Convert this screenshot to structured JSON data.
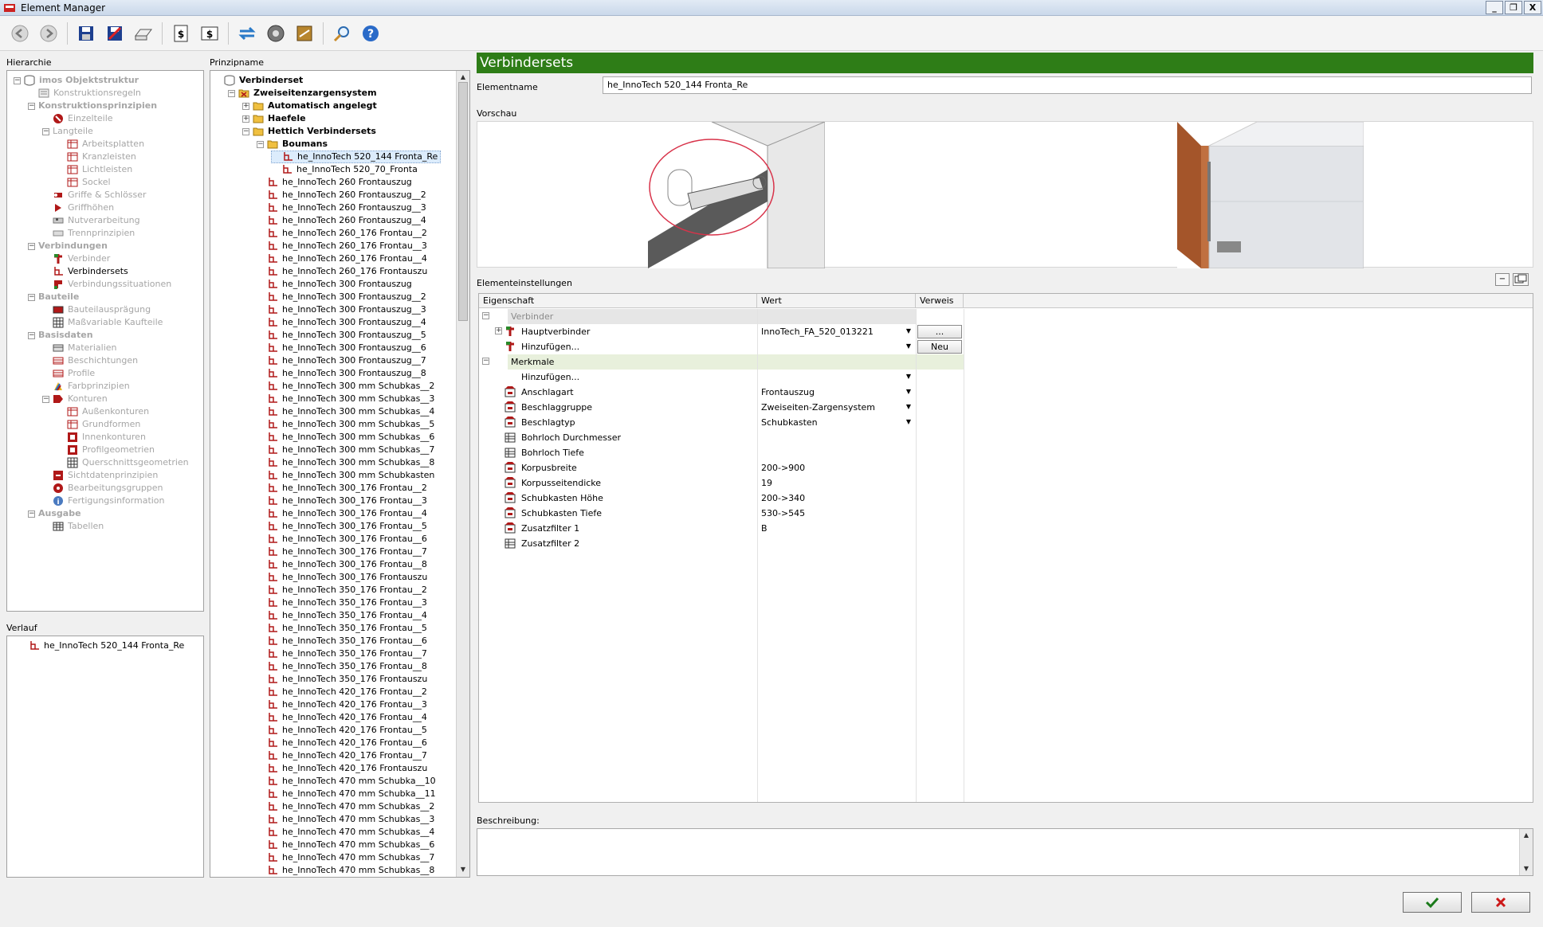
{
  "window": {
    "title": "Element Manager",
    "minimize": "_",
    "restore": "❐",
    "close": "X"
  },
  "panels": {
    "hierarchy_label": "Hierarchie",
    "principle_label": "Prinzipname",
    "history_label": "Verlauf",
    "preview_label": "Vorschau",
    "settings_label": "Elementeinstellungen",
    "description_label": "Beschreibung:",
    "element_name_label": "Elementname"
  },
  "hierarchy": [
    {
      "label": "imos Objektstruktur",
      "style": "greyb",
      "level": 0,
      "pm": "-",
      "icon": "db"
    },
    {
      "label": "Konstruktionsregeln",
      "style": "grey",
      "level": 1,
      "pm": "",
      "icon": "rule"
    },
    {
      "label": "Konstruktionsprinzipien",
      "style": "greyb",
      "level": 1,
      "pm": "-",
      "icon": ""
    },
    {
      "label": "Einzelteile",
      "style": "grey",
      "level": 2,
      "pm": "",
      "icon": "part"
    },
    {
      "label": "Langteile",
      "style": "grey",
      "level": 2,
      "pm": "-",
      "icon": ""
    },
    {
      "label": "Arbeitsplatten",
      "style": "grey",
      "level": 3,
      "pm": "",
      "icon": "board"
    },
    {
      "label": "Kranzleisten",
      "style": "grey",
      "level": 3,
      "pm": "",
      "icon": "board"
    },
    {
      "label": "Lichtleisten",
      "style": "grey",
      "level": 3,
      "pm": "",
      "icon": "board"
    },
    {
      "label": "Sockel",
      "style": "grey",
      "level": 3,
      "pm": "",
      "icon": "board"
    },
    {
      "label": "Griffe & Schlösser",
      "style": "grey",
      "level": 2,
      "pm": "",
      "icon": "handle"
    },
    {
      "label": "Griffhöhen",
      "style": "grey",
      "level": 2,
      "pm": "",
      "icon": "handle2"
    },
    {
      "label": "Nutverarbeitung",
      "style": "grey",
      "level": 2,
      "pm": "",
      "icon": "groove"
    },
    {
      "label": "Trennprinzipien",
      "style": "grey",
      "level": 2,
      "pm": "",
      "icon": "sep"
    },
    {
      "label": "Verbindungen",
      "style": "greyb",
      "level": 1,
      "pm": "-",
      "icon": ""
    },
    {
      "label": "Verbinder",
      "style": "grey",
      "level": 2,
      "pm": "",
      "icon": "conn"
    },
    {
      "label": "Verbindersets",
      "style": "",
      "level": 2,
      "pm": "",
      "icon": "connset"
    },
    {
      "label": "Verbindungssituationen",
      "style": "grey",
      "level": 2,
      "pm": "",
      "icon": "sit"
    },
    {
      "label": "Bauteile",
      "style": "greyb",
      "level": 1,
      "pm": "-",
      "icon": ""
    },
    {
      "label": "Bauteilausprägung",
      "style": "grey",
      "level": 2,
      "pm": "",
      "icon": "comp"
    },
    {
      "label": "Maßvariable Kaufteile",
      "style": "grey",
      "level": 2,
      "pm": "",
      "icon": "grid"
    },
    {
      "label": "Basisdaten",
      "style": "greyb",
      "level": 1,
      "pm": "-",
      "icon": ""
    },
    {
      "label": "Materialien",
      "style": "grey",
      "level": 2,
      "pm": "",
      "icon": "mat"
    },
    {
      "label": "Beschichtungen",
      "style": "grey",
      "level": 2,
      "pm": "",
      "icon": "coat"
    },
    {
      "label": "Profile",
      "style": "grey",
      "level": 2,
      "pm": "",
      "icon": "coat"
    },
    {
      "label": "Farbprinzipien",
      "style": "grey",
      "level": 2,
      "pm": "",
      "icon": "color"
    },
    {
      "label": "Konturen",
      "style": "grey",
      "level": 2,
      "pm": "-",
      "icon": "contour"
    },
    {
      "label": "Außenkonturen",
      "style": "grey",
      "level": 3,
      "pm": "",
      "icon": "board"
    },
    {
      "label": "Grundformen",
      "style": "grey",
      "level": 3,
      "pm": "",
      "icon": "board"
    },
    {
      "label": "Innenkonturen",
      "style": "grey",
      "level": 3,
      "pm": "",
      "icon": "inner"
    },
    {
      "label": "Profilgeometrien",
      "style": "grey",
      "level": 3,
      "pm": "",
      "icon": "inner"
    },
    {
      "label": "Querschnittsgeometrien",
      "style": "grey",
      "level": 3,
      "pm": "",
      "icon": "grid"
    },
    {
      "label": "Sichtdatenprinzipien",
      "style": "grey",
      "level": 2,
      "pm": "",
      "icon": "view"
    },
    {
      "label": "Bearbeitungsgruppen",
      "style": "grey",
      "level": 2,
      "pm": "",
      "icon": "group"
    },
    {
      "label": "Fertigungsinformation",
      "style": "grey",
      "level": 2,
      "pm": "",
      "icon": "info"
    },
    {
      "label": "Ausgabe",
      "style": "greyb",
      "level": 1,
      "pm": "-",
      "icon": ""
    },
    {
      "label": "Tabellen",
      "style": "grey",
      "level": 2,
      "pm": "",
      "icon": "table"
    }
  ],
  "history": [
    "he_InnoTech 520_144 Fronta_Re"
  ],
  "principles_top": [
    {
      "label": "Verbinderset",
      "style": "bold",
      "indent": 0,
      "pm": "",
      "icon": "db"
    },
    {
      "label": "Zweiseitenzargensystem",
      "style": "bold",
      "indent": 1,
      "pm": "-",
      "icon": "folderx"
    },
    {
      "label": "Automatisch angelegt",
      "style": "bold",
      "indent": 2,
      "pm": "+",
      "icon": "folder"
    },
    {
      "label": "Haefele",
      "style": "bold",
      "indent": 2,
      "pm": "+",
      "icon": "folder"
    },
    {
      "label": "Hettich Verbindersets",
      "style": "bold",
      "indent": 2,
      "pm": "-",
      "icon": "folder"
    },
    {
      "label": "Boumans",
      "style": "bold",
      "indent": 3,
      "pm": "-",
      "icon": "folder"
    },
    {
      "label": "he_InnoTech 520_144 Fronta_Re",
      "style": "sel",
      "indent": 4,
      "pm": "",
      "icon": "connset"
    },
    {
      "label": "he_InnoTech 520_70_Fronta",
      "style": "",
      "indent": 4,
      "pm": "",
      "icon": "connset"
    }
  ],
  "principles_items": [
    "he_InnoTech 260 Frontauszug",
    "he_InnoTech 260 Frontauszug__2",
    "he_InnoTech 260 Frontauszug__3",
    "he_InnoTech 260 Frontauszug__4",
    "he_InnoTech 260_176 Frontau__2",
    "he_InnoTech 260_176 Frontau__3",
    "he_InnoTech 260_176 Frontau__4",
    "he_InnoTech 260_176 Frontauszu",
    "he_InnoTech 300 Frontauszug",
    "he_InnoTech 300 Frontauszug__2",
    "he_InnoTech 300 Frontauszug__3",
    "he_InnoTech 300 Frontauszug__4",
    "he_InnoTech 300 Frontauszug__5",
    "he_InnoTech 300 Frontauszug__6",
    "he_InnoTech 300 Frontauszug__7",
    "he_InnoTech 300 Frontauszug__8",
    "he_InnoTech 300 mm Schubkas__2",
    "he_InnoTech 300 mm Schubkas__3",
    "he_InnoTech 300 mm Schubkas__4",
    "he_InnoTech 300 mm Schubkas__5",
    "he_InnoTech 300 mm Schubkas__6",
    "he_InnoTech 300 mm Schubkas__7",
    "he_InnoTech 300 mm Schubkas__8",
    "he_InnoTech 300 mm Schubkasten",
    "he_InnoTech 300_176 Frontau__2",
    "he_InnoTech 300_176 Frontau__3",
    "he_InnoTech 300_176 Frontau__4",
    "he_InnoTech 300_176 Frontau__5",
    "he_InnoTech 300_176 Frontau__6",
    "he_InnoTech 300_176 Frontau__7",
    "he_InnoTech 300_176 Frontau__8",
    "he_InnoTech 300_176 Frontauszu",
    "he_InnoTech 350_176 Frontau__2",
    "he_InnoTech 350_176 Frontau__3",
    "he_InnoTech 350_176 Frontau__4",
    "he_InnoTech 350_176 Frontau__5",
    "he_InnoTech 350_176 Frontau__6",
    "he_InnoTech 350_176 Frontau__7",
    "he_InnoTech 350_176 Frontau__8",
    "he_InnoTech 350_176 Frontauszu",
    "he_InnoTech 420_176 Frontau__2",
    "he_InnoTech 420_176 Frontau__3",
    "he_InnoTech 420_176 Frontau__4",
    "he_InnoTech 420_176 Frontau__5",
    "he_InnoTech 420_176 Frontau__6",
    "he_InnoTech 420_176 Frontau__7",
    "he_InnoTech 420_176 Frontauszu",
    "he_InnoTech 470 mm Schubka__10",
    "he_InnoTech 470 mm Schubka__11",
    "he_InnoTech 470 mm Schubkas__2",
    "he_InnoTech 470 mm Schubkas__3",
    "he_InnoTech 470 mm Schubkas__4",
    "he_InnoTech 470 mm Schubkas__6",
    "he_InnoTech 470 mm Schubkas__7",
    "he_InnoTech 470 mm Schubkas__8"
  ],
  "detail": {
    "header": "Verbindersets",
    "element_name": "he_InnoTech 520_144 Fronta_Re"
  },
  "grid": {
    "columns": [
      "Eigenschaft",
      "Wert",
      "Verweis"
    ],
    "rows": [
      {
        "type": "group",
        "pm": "-",
        "label": "Verbinder",
        "grey": true
      },
      {
        "type": "row",
        "pm": "+",
        "icon": "conn",
        "label": "Hauptverbinder",
        "value": "InnoTech_FA_520_013221",
        "dropdown": true,
        "ref": "..."
      },
      {
        "type": "row",
        "pm": "",
        "icon": "conn",
        "label": "Hinzufügen...",
        "value": "",
        "dropdown": true,
        "ref": "Neu"
      },
      {
        "type": "group",
        "pm": "-",
        "label": "Merkmale",
        "grey": false
      },
      {
        "type": "row",
        "pm": "",
        "icon": "",
        "label": "Hinzufügen...",
        "value": "",
        "dropdown": true,
        "ref": ""
      },
      {
        "type": "row",
        "pm": "",
        "icon": "feat",
        "label": "Anschlagart",
        "value": "Frontauszug",
        "dropdown": true,
        "ref": ""
      },
      {
        "type": "row",
        "pm": "",
        "icon": "feat",
        "label": "Beschlaggruppe",
        "value": "Zweiseiten-Zargensystem",
        "dropdown": true,
        "ref": ""
      },
      {
        "type": "row",
        "pm": "",
        "icon": "feat",
        "label": "Beschlagtyp",
        "value": "Schubkasten",
        "dropdown": true,
        "ref": ""
      },
      {
        "type": "row",
        "pm": "",
        "icon": "featg",
        "label": "Bohrloch Durchmesser",
        "value": "",
        "dropdown": false,
        "ref": ""
      },
      {
        "type": "row",
        "pm": "",
        "icon": "featg",
        "label": "Bohrloch Tiefe",
        "value": "",
        "dropdown": false,
        "ref": ""
      },
      {
        "type": "row",
        "pm": "",
        "icon": "feat",
        "label": "Korpusbreite",
        "value": "200->900",
        "dropdown": false,
        "ref": ""
      },
      {
        "type": "row",
        "pm": "",
        "icon": "feat",
        "label": "Korpusseitendicke",
        "value": "19",
        "dropdown": false,
        "ref": ""
      },
      {
        "type": "row",
        "pm": "",
        "icon": "feat",
        "label": "Schubkasten Höhe",
        "value": "200->340",
        "dropdown": false,
        "ref": ""
      },
      {
        "type": "row",
        "pm": "",
        "icon": "feat",
        "label": "Schubkasten Tiefe",
        "value": "530->545",
        "dropdown": false,
        "ref": ""
      },
      {
        "type": "row",
        "pm": "",
        "icon": "feat",
        "label": "Zusatzfilter 1",
        "value": "B",
        "dropdown": false,
        "ref": ""
      },
      {
        "type": "row",
        "pm": "",
        "icon": "featg",
        "label": "Zusatzfilter 2",
        "value": "",
        "dropdown": false,
        "ref": ""
      }
    ]
  },
  "colors": {
    "header_green": "#2e7d17",
    "icon_red": "#b01818",
    "selection": "#dcecfc"
  },
  "toolbar_icons": [
    "back-icon",
    "forward-icon",
    "save-icon",
    "save-as-icon",
    "print-icon",
    "price-icon",
    "price-list-icon",
    "swap-icon",
    "disk-icon",
    "package-icon",
    "search-icon",
    "help-icon"
  ]
}
